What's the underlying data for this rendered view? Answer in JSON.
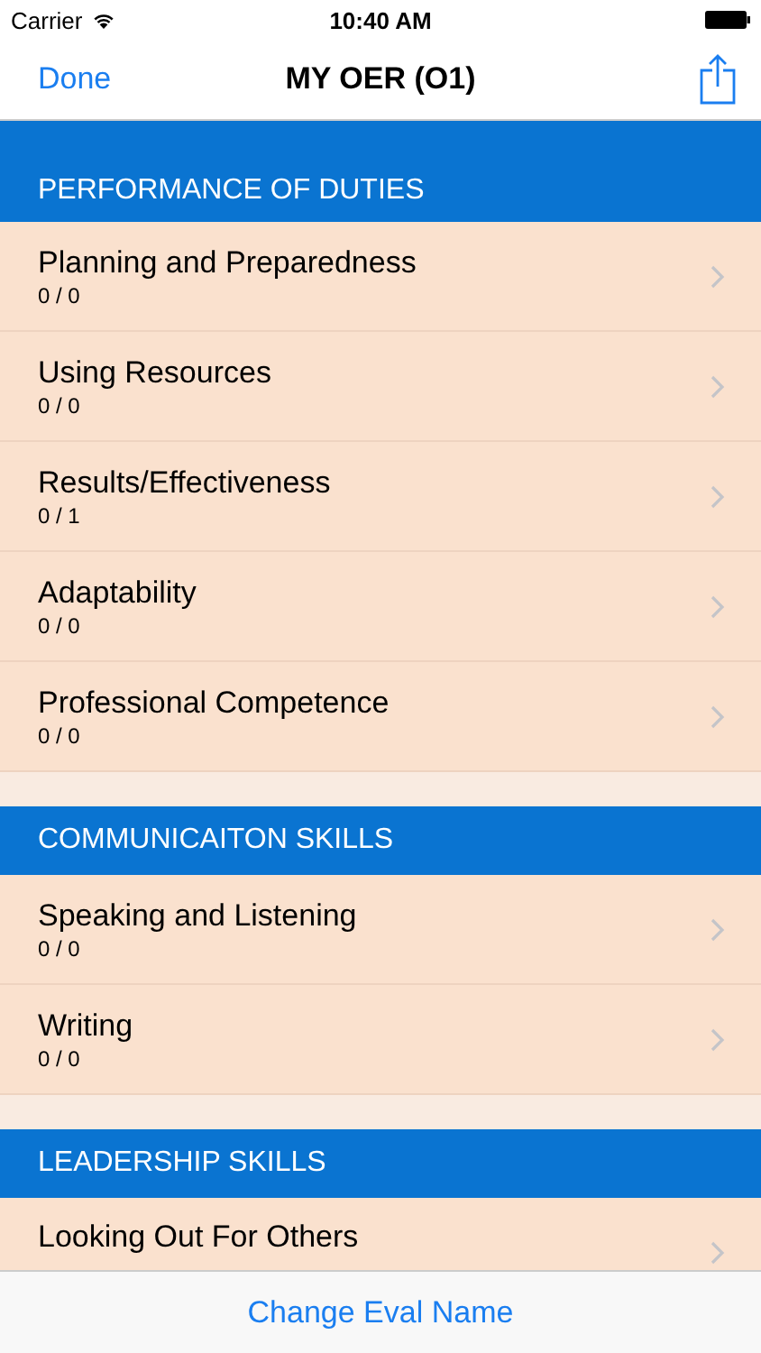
{
  "status_bar": {
    "carrier": "Carrier",
    "time": "10:40 AM"
  },
  "nav": {
    "left": "Done",
    "title": "MY OER (O1)"
  },
  "sections": [
    {
      "title": "PERFORMANCE OF DUTIES",
      "rows": [
        {
          "title": "Planning and Preparedness",
          "score": "0 / 0"
        },
        {
          "title": "Using Resources",
          "score": "0 / 0"
        },
        {
          "title": "Results/Effectiveness",
          "score": "0 / 1"
        },
        {
          "title": "Adaptability",
          "score": "0 / 0"
        },
        {
          "title": "Professional Competence",
          "score": "0 / 0"
        }
      ]
    },
    {
      "title": "COMMUNICAITON SKILLS",
      "rows": [
        {
          "title": "Speaking and Listening",
          "score": "0 / 0"
        },
        {
          "title": "Writing",
          "score": "0 / 0"
        }
      ]
    },
    {
      "title": "LEADERSHIP SKILLS",
      "rows": [
        {
          "title": "Looking Out For Others"
        }
      ]
    }
  ],
  "toolbar": {
    "button": "Change Eval Name"
  }
}
